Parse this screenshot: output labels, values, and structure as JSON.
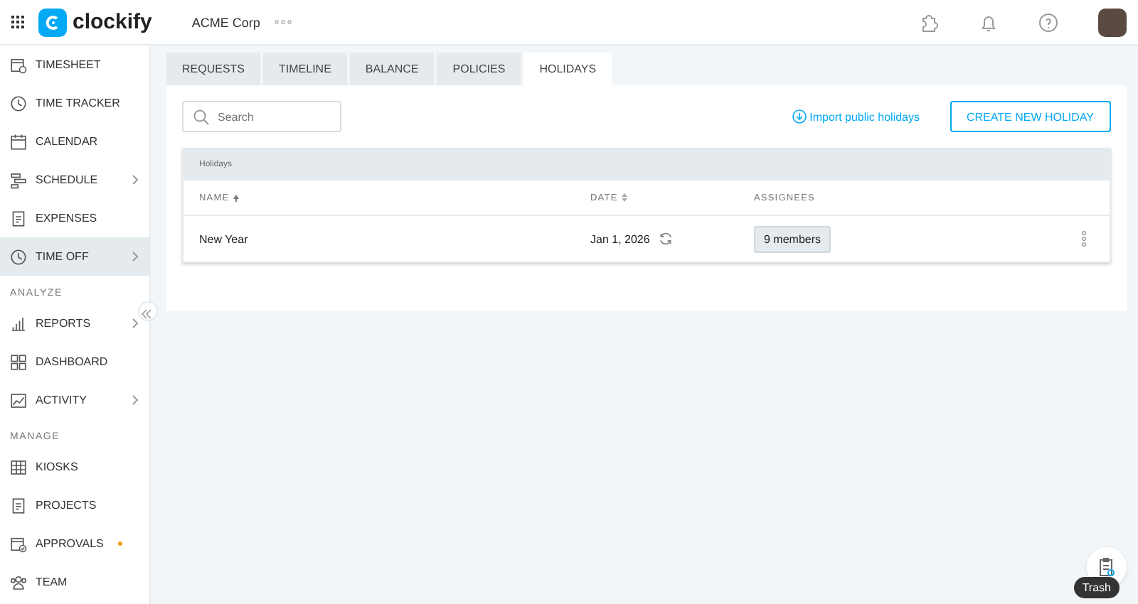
{
  "header": {
    "logo": "clockify",
    "workspace": "ACME Corp"
  },
  "sidebar": {
    "sections": [
      {
        "items": [
          {
            "label": "TIMESHEET",
            "expandable": false,
            "selected": false,
            "notification": false
          },
          {
            "label": "TIME TRACKER",
            "expandable": false,
            "selected": false,
            "notification": false
          },
          {
            "label": "CALENDAR",
            "expandable": false,
            "selected": false,
            "notification": false
          },
          {
            "label": "SCHEDULE",
            "expandable": true,
            "selected": false,
            "notification": false
          },
          {
            "label": "EXPENSES",
            "expandable": false,
            "selected": false,
            "notification": false
          },
          {
            "label": "TIME OFF",
            "expandable": true,
            "selected": true,
            "notification": false
          }
        ]
      },
      {
        "heading": "ANALYZE",
        "items": [
          {
            "label": "REPORTS",
            "expandable": true,
            "selected": false,
            "notification": false
          },
          {
            "label": "DASHBOARD",
            "expandable": false,
            "selected": false,
            "notification": false
          },
          {
            "label": "ACTIVITY",
            "expandable": true,
            "selected": false,
            "notification": false
          }
        ]
      },
      {
        "heading": "MANAGE",
        "items": [
          {
            "label": "KIOSKS",
            "expandable": false,
            "selected": false,
            "notification": false
          },
          {
            "label": "PROJECTS",
            "expandable": false,
            "selected": false,
            "notification": false
          },
          {
            "label": "APPROVALS",
            "expandable": false,
            "selected": false,
            "notification": true
          },
          {
            "label": "TEAM",
            "expandable": false,
            "selected": false,
            "notification": false
          }
        ]
      }
    ]
  },
  "tabs": [
    {
      "label": "REQUESTS",
      "selected": false
    },
    {
      "label": "TIMELINE",
      "selected": false
    },
    {
      "label": "BALANCE",
      "selected": false
    },
    {
      "label": "POLICIES",
      "selected": false
    },
    {
      "label": "HOLIDAYS",
      "selected": true
    }
  ],
  "search": {
    "placeholder": "Search"
  },
  "import_link": "Import public holidays",
  "create_button": "CREATE NEW HOLIDAY",
  "table": {
    "title": "Holidays",
    "columns": [
      {
        "label": "NAME",
        "sortable": true,
        "sorted": true
      },
      {
        "label": "DATE",
        "sortable": true,
        "sorted": false
      },
      {
        "label": "ASSIGNEES",
        "sortable": false
      }
    ],
    "rows": [
      {
        "name": "New Year",
        "date": "Jan 1, 2026",
        "recurring": true,
        "assignees": "9 members"
      }
    ]
  },
  "tooltip": "Trash"
}
